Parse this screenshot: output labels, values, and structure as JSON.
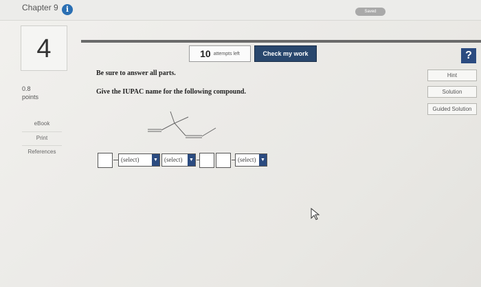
{
  "header": {
    "chapter": "Chapter 9",
    "info_icon": "info-icon",
    "saved_label": "Saved"
  },
  "question": {
    "number": "4",
    "points_value": "0.8",
    "points_label": "points",
    "instruction": "Be sure to answer all parts.",
    "prompt": "Give the IUPAC name for the following compound."
  },
  "attempts": {
    "count": "10",
    "label": "attempts left"
  },
  "toolbar": {
    "check_label": "Check my work",
    "help_label": "?"
  },
  "side_buttons": {
    "hint": "Hint",
    "solution": "Solution",
    "guided_solution": "Guided Solution"
  },
  "left_links": {
    "ebook": "eBook",
    "print": "Print",
    "references": "References"
  },
  "answer": {
    "select1": "(select)",
    "select2": "(select)",
    "select3": "(select)",
    "dropdown_icon": "chevron-down-icon"
  },
  "colors": {
    "check_button": "#29476d",
    "help_button": "#2b4b80",
    "saved_badge": "#a9a9a9"
  }
}
